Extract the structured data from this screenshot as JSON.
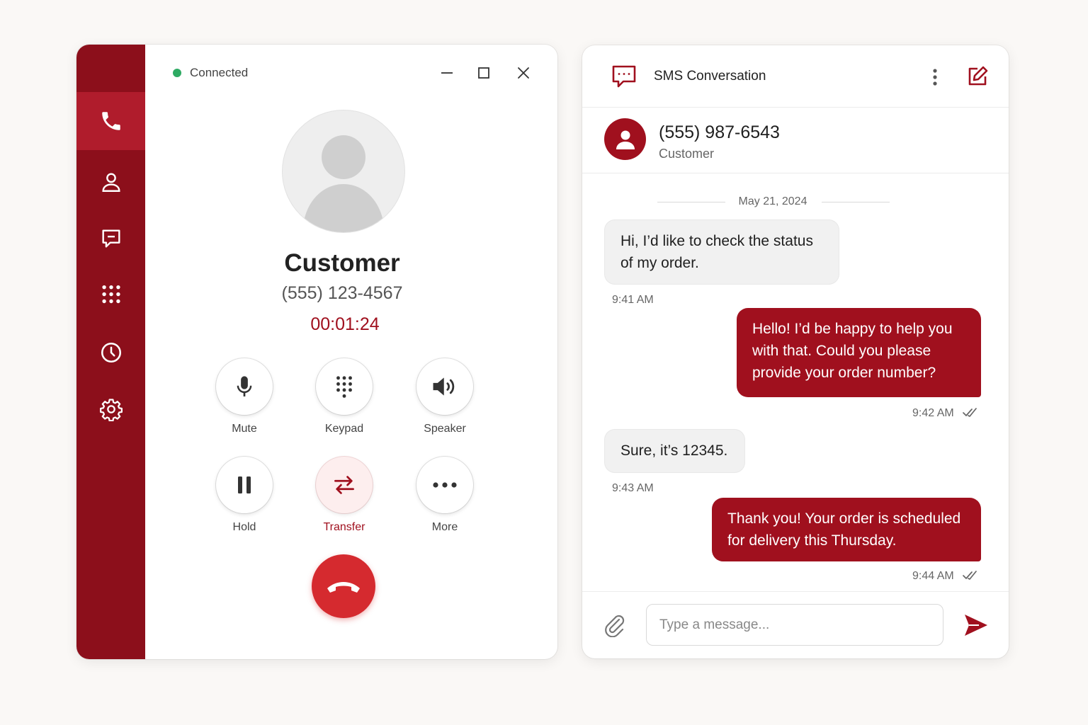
{
  "call": {
    "status": "Connected",
    "caller_name": "Customer",
    "caller_number": "(555) 123-4567",
    "timer": "00:01:24",
    "controls": [
      {
        "label": "Mute",
        "icon": "microphone-icon"
      },
      {
        "label": "Keypad",
        "icon": "keypad-icon"
      },
      {
        "label": "Speaker",
        "icon": "speaker-icon"
      },
      {
        "label": "Hold",
        "icon": "pause-icon"
      },
      {
        "label": "Transfer",
        "icon": "transfer-icon",
        "accent": true
      },
      {
        "label": "More",
        "icon": "more-icon"
      }
    ],
    "rail_items": [
      "phone-icon",
      "contacts-icon",
      "messages-icon",
      "dialpad-icon",
      "history-icon",
      "settings-icon"
    ],
    "active_rail": "phone-icon",
    "colors": {
      "brand": "#8c0f1b",
      "brand_active": "#b01c2c",
      "status": "#2eaa63",
      "hangup": "#d52a2f",
      "accent_text": "#a0101e"
    }
  },
  "sms": {
    "title": "SMS Conversation",
    "contact": {
      "number": "(555) 987-6543",
      "role": "Customer"
    },
    "date": "May 21, 2024",
    "messages": [
      {
        "direction": "in",
        "lines": [
          "Hi, I’d like to check the status",
          "of my order."
        ],
        "time": "9:41 AM"
      },
      {
        "direction": "out",
        "lines": [
          "Hello! I’d be happy to help you",
          "with that. Could you please",
          "provide your order number?"
        ],
        "time": "9:42 AM"
      },
      {
        "direction": "in",
        "lines": [
          "Sure, it’s 12345."
        ],
        "time": "9:43 AM"
      },
      {
        "direction": "out",
        "lines": [
          "Thank you! Your order is scheduled",
          "for delivery this Thursday."
        ],
        "time": "9:44 AM"
      }
    ],
    "composer_placeholder": "Type a message...",
    "colors": {
      "outgoing": "#a0101e",
      "incoming": "#f1f1f1"
    }
  }
}
